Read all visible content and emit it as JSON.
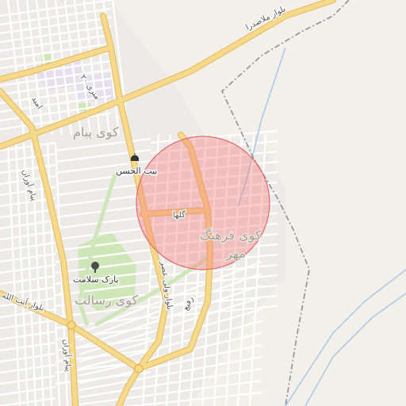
{
  "map": {
    "roads": {
      "boulevard_north": "بلوار ملاصدرا",
      "boulevard_west": "بلوار آیت الله",
      "street_20m": "۲۰ متری",
      "street_amid": "امید",
      "street_payam_avaran_upper": "پیام آوران",
      "street_payam_avaran_lower": "پیام آوران",
      "street_golha": "گلها",
      "street_vali_asr": "بلوار ولی عصر",
      "street_rafie": "رفیع"
    },
    "districts": {
      "kuye_payam": "کوی پیام",
      "kuye_farhang": "کوی فرهنگ",
      "kuye_farhang_2": "مهر",
      "kuye_resalat": "کوی رسالت"
    },
    "pois": {
      "beit_al_hasan": "بیت الحسن",
      "park_salamat": "پارک سلامت"
    },
    "colors": {
      "background": "#f3f0ea",
      "major_road": "#f7d98b",
      "major_road_casing": "#e2b95a",
      "minor_road": "#ffffff",
      "park": "#cfe6b8",
      "highlight_circle": "#f48a8a",
      "boundary": "#8d8ea0",
      "river": "#a9c8e8"
    },
    "highlight": {
      "shape": "circle"
    },
    "icons": [
      "mosque-icon",
      "tree-icon"
    ]
  }
}
